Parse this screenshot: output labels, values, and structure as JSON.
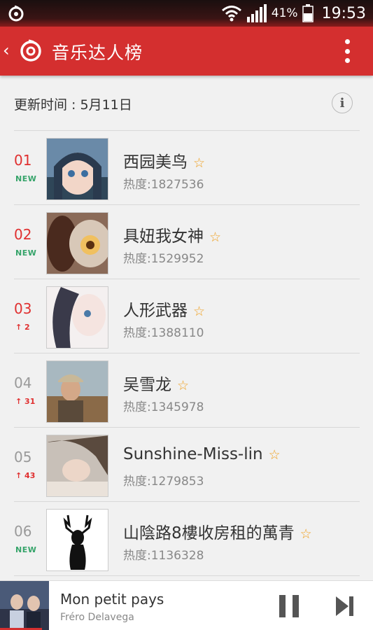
{
  "status_bar": {
    "battery": "41%",
    "time": "19:53"
  },
  "app_bar": {
    "title": "音乐达人榜"
  },
  "update": {
    "text": "更新时间 : 5月11日"
  },
  "rows": [
    {
      "rank": "01",
      "change": "NEW",
      "name": "西园美鸟",
      "heat": "热度:1827536"
    },
    {
      "rank": "02",
      "change": "NEW",
      "name": "具妞我女神",
      "heat": "热度:1529952"
    },
    {
      "rank": "03",
      "change": "↑ 2",
      "name": "人形武器",
      "heat": "热度:1388110"
    },
    {
      "rank": "04",
      "change": "↑ 31",
      "name": "吴雪龙",
      "heat": "热度:1345978"
    },
    {
      "rank": "05",
      "change": "↑ 43",
      "name": "Sunshine-Miss-lin",
      "heat": "热度:1279853"
    },
    {
      "rank": "06",
      "change": "NEW",
      "name": "山陰路8樓收房租的萬青",
      "heat": "热度:1136328"
    }
  ],
  "player": {
    "title": "Mon petit pays",
    "artist": "Fréro Delavega"
  },
  "colors": {
    "brand_red": "#d42f2f",
    "new_green": "#36a46a",
    "star": "#f0a020"
  },
  "icons": {
    "back": "chevron-left-icon",
    "logo": "netease-music-icon",
    "more": "overflow-menu-icon",
    "info": "info-icon"
  }
}
